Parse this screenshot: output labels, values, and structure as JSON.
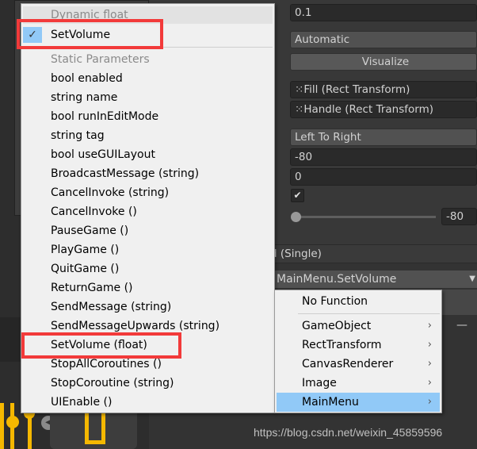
{
  "inspector": {
    "value_field": "0.1",
    "navigation_dropdown": "Automatic",
    "visualize_button": "Visualize",
    "fill_rect": "Fill (Rect Transform)",
    "handle_rect": "Handle (Rect Transform)",
    "direction": "Left To Right",
    "min_value": "-80",
    "max_value": "0",
    "whole_numbers_checked": true,
    "slider_value": "-80",
    "event_header": "d (Single)",
    "function_dropdown": "MainMenu.SetVolume"
  },
  "function_menu": {
    "dynamic_header": "Dynamic float",
    "dynamic_items": [
      {
        "label": "SetVolume",
        "checked": true
      }
    ],
    "static_header": "Static Parameters",
    "static_items": [
      "bool enabled",
      "string name",
      "bool runInEditMode",
      "string tag",
      "bool useGUILayout",
      "BroadcastMessage (string)",
      "CancelInvoke (string)",
      "CancelInvoke ()",
      "PauseGame ()",
      "PlayGame ()",
      "QuitGame ()",
      "ReturnGame ()",
      "SendMessage (string)",
      "SendMessageUpwards (string)",
      "SetVolume (float)",
      "StopAllCoroutines ()",
      "StopCoroutine (string)",
      "UIEnable ()"
    ]
  },
  "component_menu": {
    "no_function": "No Function",
    "items": [
      "GameObject",
      "RectTransform",
      "CanvasRenderer",
      "Image",
      "MainMenu"
    ],
    "selected": "MainMenu"
  },
  "colors": {
    "highlight": "#91c9f7",
    "annotation": "#f23a3a",
    "icon_yellow": "#f5b800"
  },
  "watermark": "https://blog.csdn.net/weixin_45859596"
}
